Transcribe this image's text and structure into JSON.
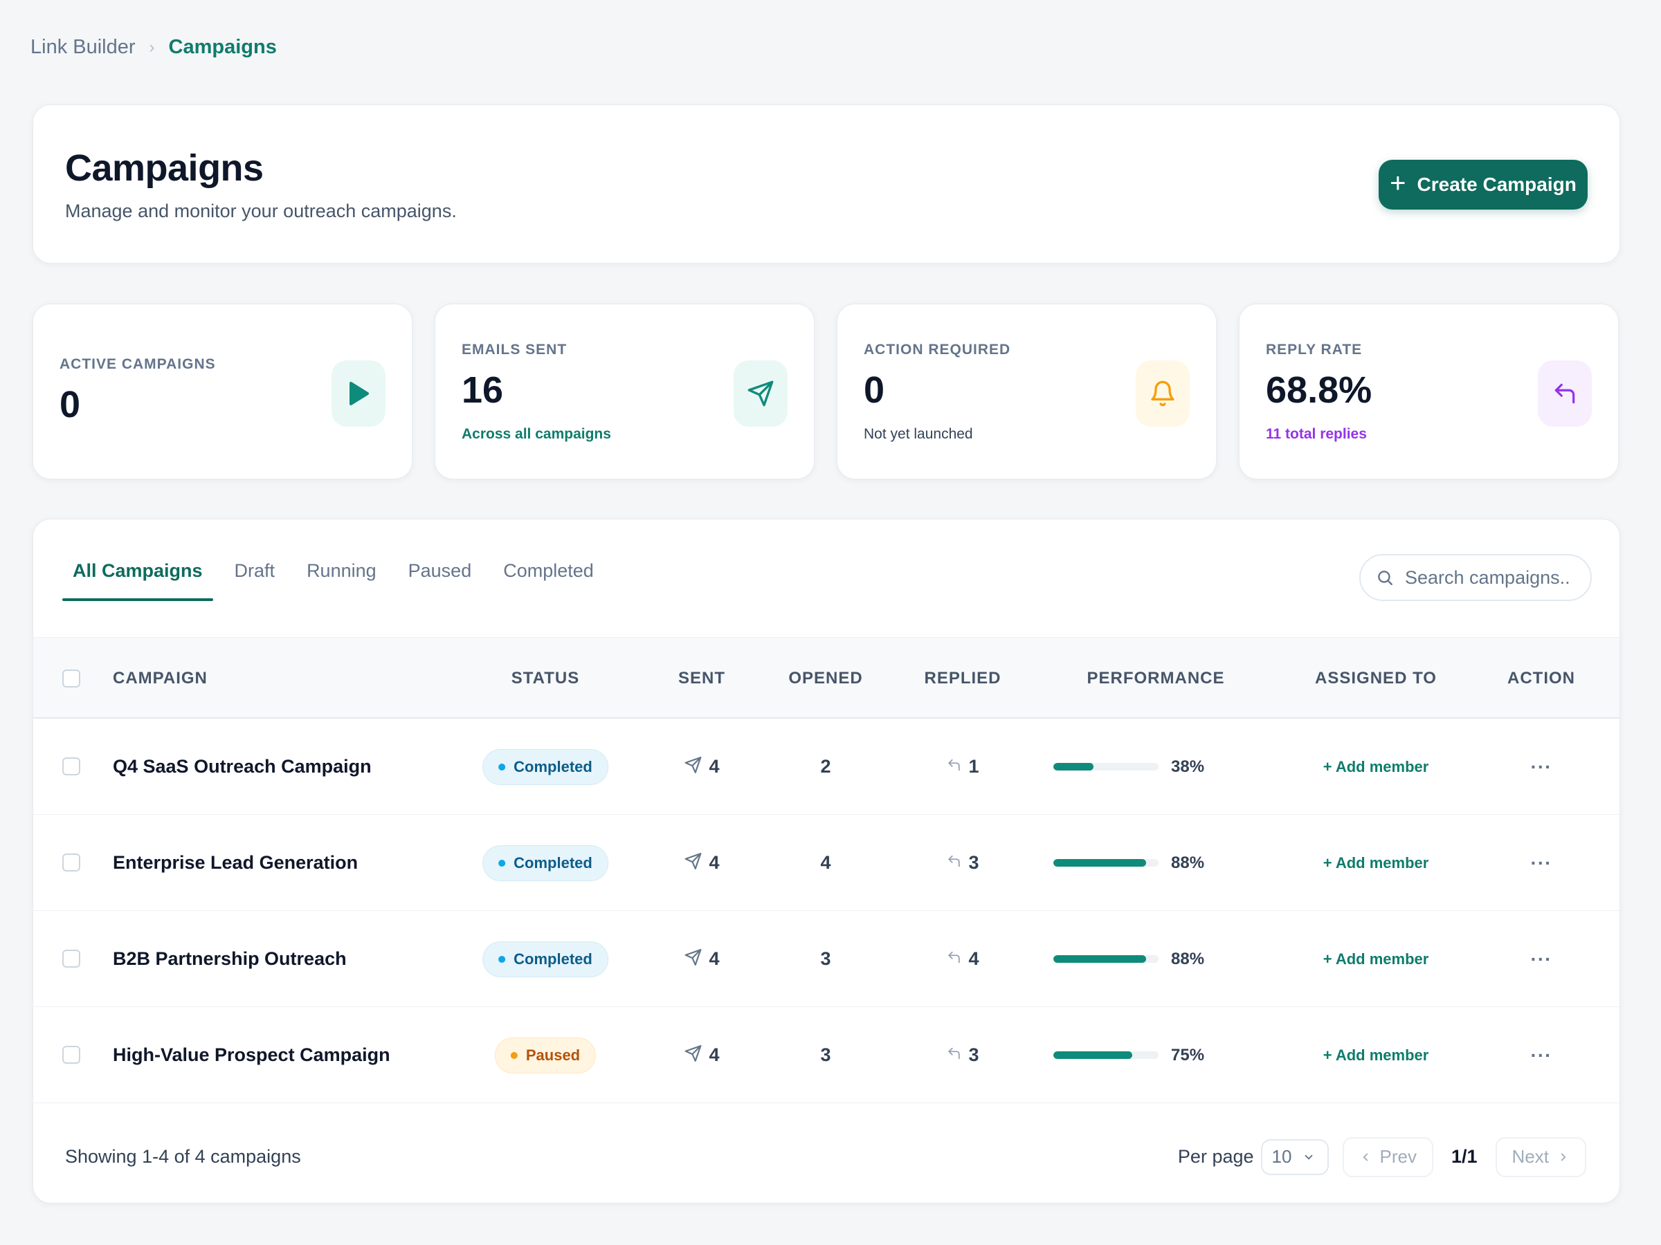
{
  "breadcrumb": {
    "root": "Link Builder",
    "separator": "›",
    "current": "Campaigns"
  },
  "header": {
    "title": "Campaigns",
    "subtitle": "Manage and monitor your outreach campaigns.",
    "create_button": "Create Campaign"
  },
  "stats": [
    {
      "label": "ACTIVE CAMPAIGNS",
      "value": "0",
      "sub": "",
      "icon": "play-icon",
      "color": "#0f8b7b"
    },
    {
      "label": "EMAILS SENT",
      "value": "16",
      "sub": "Across all campaigns",
      "icon": "send-icon",
      "color": "#0f8b7b"
    },
    {
      "label": "ACTION REQUIRED",
      "value": "0",
      "sub": "Not yet launched",
      "icon": "bell-icon",
      "color": "#f59e0b"
    },
    {
      "label": "REPLY RATE",
      "value": "68.8%",
      "sub": "11 total replies",
      "icon": "reply-icon",
      "color": "#9333ea"
    }
  ],
  "tabs": [
    "All Campaigns",
    "Draft",
    "Running",
    "Paused",
    "Completed"
  ],
  "active_tab": "All Campaigns",
  "search": {
    "placeholder": "Search campaigns..."
  },
  "table": {
    "columns": [
      "CAMPAIGN",
      "STATUS",
      "SENT",
      "OPENED",
      "REPLIED",
      "PERFORMANCE",
      "ASSIGNED TO",
      "ACTION"
    ],
    "rows": [
      {
        "name": "Q4 SaaS Outreach Campaign",
        "status": "Completed",
        "sent": "4",
        "opened": "2",
        "replied": "1",
        "performance": 38,
        "performance_label": "38%",
        "assigned": "+ Add member",
        "action": "···"
      },
      {
        "name": "Enterprise Lead Generation",
        "status": "Completed",
        "sent": "4",
        "opened": "4",
        "replied": "3",
        "performance": 88,
        "performance_label": "88%",
        "assigned": "+ Add member",
        "action": "···"
      },
      {
        "name": "B2B Partnership Outreach",
        "status": "Completed",
        "sent": "4",
        "opened": "3",
        "replied": "4",
        "performance": 88,
        "performance_label": "88%",
        "assigned": "+ Add member",
        "action": "···"
      },
      {
        "name": "High-Value Prospect Campaign",
        "status": "Paused",
        "sent": "4",
        "opened": "3",
        "replied": "3",
        "performance": 75,
        "performance_label": "75%",
        "assigned": "+ Add member",
        "action": "···"
      }
    ]
  },
  "footer": {
    "showing": "Showing 1-4 of 4 campaigns",
    "per_page_label": "Per page",
    "per_page_value": "10",
    "prev": "Prev",
    "page": "1/1",
    "next": "Next"
  },
  "colors": {
    "accent": "#0e6b5d",
    "accent_light": "#0f8b7b",
    "reply_purple": "#9333ea",
    "warning": "#f59e0b",
    "info": "#0ea5e9"
  }
}
